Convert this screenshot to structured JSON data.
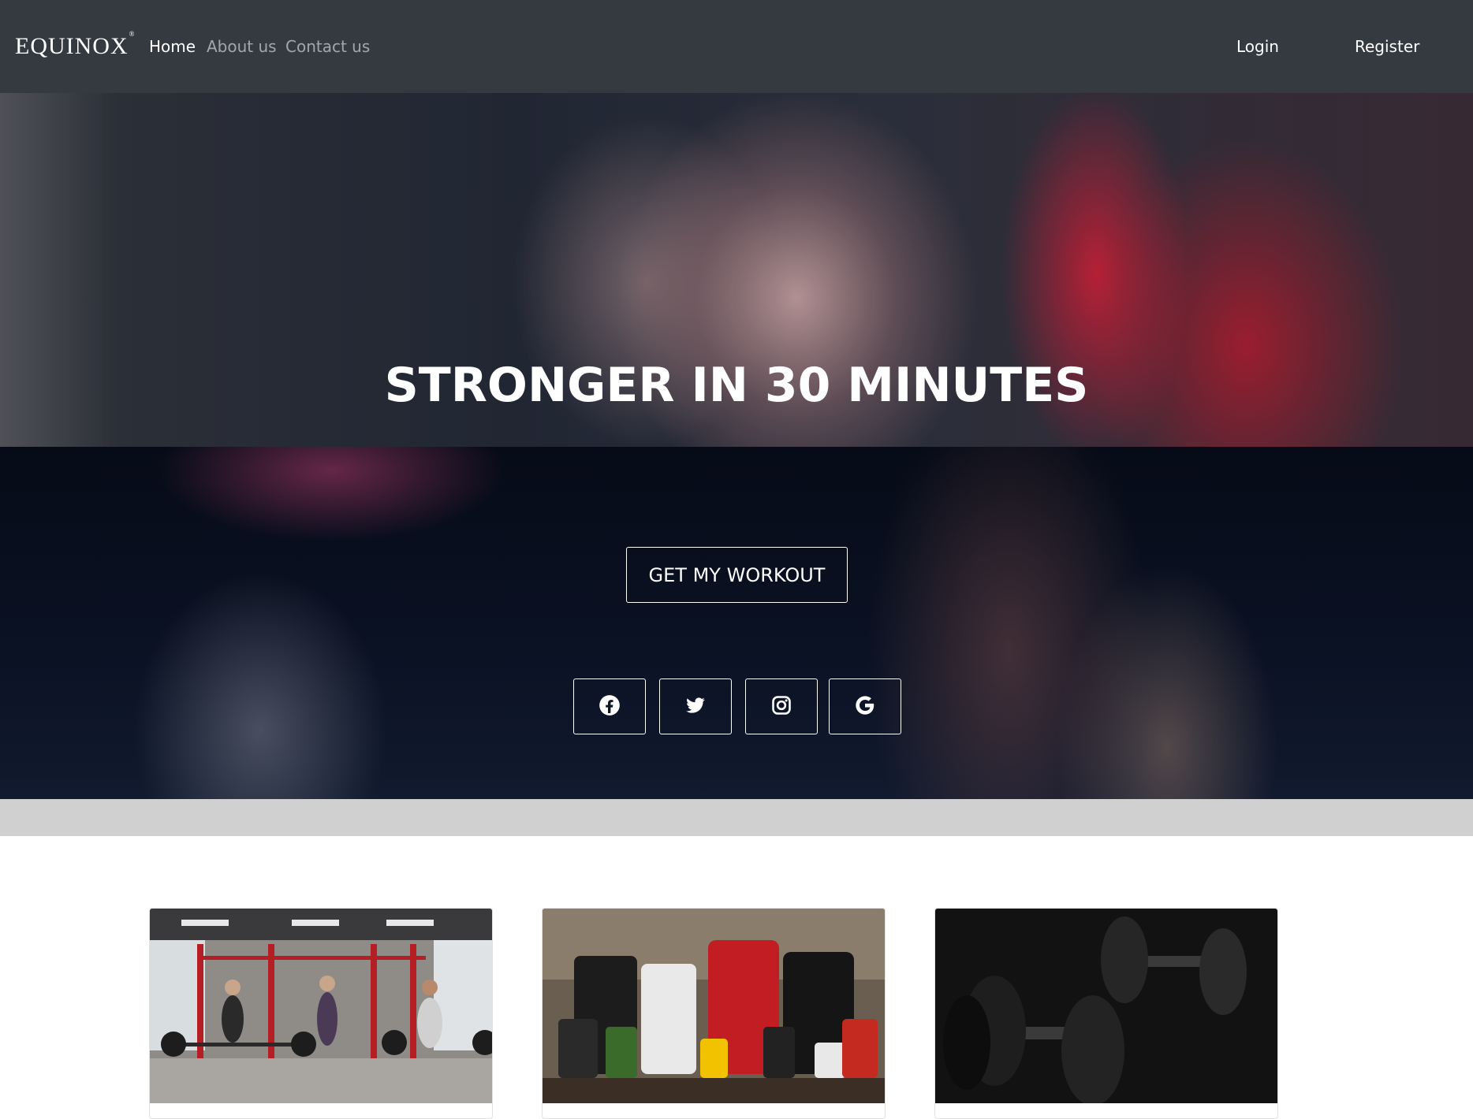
{
  "navbar": {
    "brand": "EQUINOX",
    "brand_mark": "®",
    "links": [
      {
        "label": "Home",
        "active": true
      },
      {
        "label": "About us",
        "active": false
      },
      {
        "label": "Contact us",
        "active": false
      }
    ],
    "login_label": "Login",
    "register_label": "Register",
    "background_color": "#343a40"
  },
  "hero": {
    "title": "STRONGER IN 30 MINUTES",
    "cta_label": "GET MY WORKOUT",
    "social_icons": [
      "facebook-icon",
      "twitter-icon",
      "instagram-icon",
      "google-icon"
    ]
  },
  "cards": [
    {
      "image": "gym-class-barbell-photo"
    },
    {
      "image": "supplements-products-photo"
    },
    {
      "image": "dumbbells-dark-photo"
    }
  ]
}
